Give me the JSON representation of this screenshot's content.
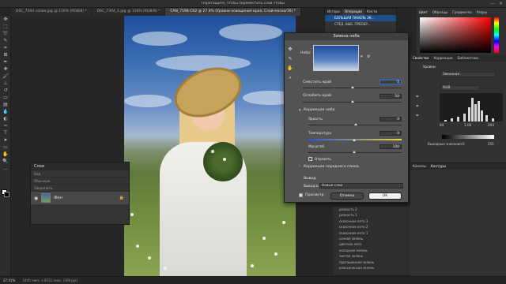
{
  "app": {
    "top_hint": "Перетащите, чтобы переместить слой чтобы",
    "publish_label": "Публикация"
  },
  "tabs": [
    {
      "label": "DSC_7304 сопия.jpg @ 116% (RGB/8) *"
    },
    {
      "label": "DSC_7304_1.jpg @ 116% (RGB/8) *"
    },
    {
      "label": "CAN_7198.CR2 @ 27.4% (Уровни освещения края, Слой-маска/16) *"
    }
  ],
  "status": {
    "zoom": "27.41%",
    "doc_size": "5445 пикс. x 8722 пикс. (300 ppi)"
  },
  "layers_panel": {
    "title": "Слои",
    "rows": [
      "Вид",
      "Обычные",
      "Закрепить",
      "Непрозрачность"
    ],
    "layer_name": "Фон"
  },
  "ops_panel": {
    "tabs": [
      "Истори",
      "Операции",
      "Кисти"
    ],
    "items": [
      "БОЛЬШАЯ ПАНЕЛЬ ЭК...",
      "СЛЕД. ВЫБ. ПРЕОБР..."
    ]
  },
  "dialog": {
    "title": "Замена неба",
    "sky_label": "Небо:",
    "shift_edge_label": "Сместить край",
    "shift_edge_value": "0",
    "fade_edge_label": "Ослабить край",
    "fade_edge_value": "50",
    "sky_adjust_label": "Коррекция неба",
    "brightness_label": "Яркость",
    "brightness_value": "0",
    "temperature_label": "Температура",
    "temperature_value": "0",
    "scale_label": "Масштаб",
    "scale_value": "100",
    "flip_label": "Отразить",
    "fg_adjust_label": "Коррекция переднего плана",
    "output_label": "Вывод",
    "output_to_label": "Вывод в:",
    "output_to_value": "Новые слои",
    "preview_label": "Просмотр",
    "cancel_label": "Отмена",
    "ok_label": "OK"
  },
  "right_panel": {
    "tabs": [
      "Цвет",
      "Образцы",
      "Градиенты",
      "Узоры"
    ],
    "props_tabs": [
      "Свойства",
      "Коррекция",
      "Библиотеки"
    ],
    "levels_label": "Уровни",
    "preset_value": "Заказная",
    "channel_value": "RGB",
    "input_values": [
      "84",
      "1,00",
      "204"
    ],
    "output_label": "Выходные значения:",
    "output_values": [
      "0",
      "255"
    ],
    "lower_tabs": [
      "Каналы",
      "Контуры"
    ]
  },
  "adjust_list": [
    "резкость 2",
    "резкость 1",
    "сказочное лето 3",
    "сказочное лето 2",
    "сказочное лето 1",
    "сочная зелень",
    "цветное лето",
    "холодная зелень",
    "чистая зелень",
    "пригашенная зелень",
    "классическая зелень"
  ],
  "colors": {
    "accent": "#1473e6",
    "panel_bg": "#323232",
    "dialog_bg": "#535353"
  }
}
